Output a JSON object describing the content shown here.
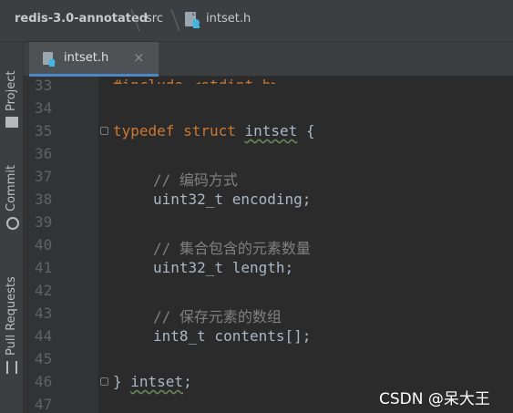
{
  "breadcrumb": {
    "project": "redis-3.0-annotated",
    "folder": "src",
    "file": "intset.h"
  },
  "side_tabs": {
    "project": "Project",
    "commit": "Commit",
    "pull_requests": "Pull Requests"
  },
  "editor_tab": {
    "label": "intset.h",
    "close": "×"
  },
  "lines": [
    {
      "num": "33",
      "code": "#include <stdint.h>"
    },
    {
      "num": "34",
      "code": ""
    },
    {
      "num": "35",
      "kw1": "typedef",
      "kw2": "struct",
      "name": "intset",
      "tail": " {"
    },
    {
      "num": "36",
      "code": ""
    },
    {
      "num": "37",
      "comment": "// 编码方式"
    },
    {
      "num": "38",
      "code": "uint32_t encoding;"
    },
    {
      "num": "39",
      "code": ""
    },
    {
      "num": "40",
      "comment": "// 集合包含的元素数量"
    },
    {
      "num": "41",
      "code": "uint32_t length;"
    },
    {
      "num": "42",
      "code": ""
    },
    {
      "num": "43",
      "comment": "// 保存元素的数组"
    },
    {
      "num": "44",
      "code": "int8_t contents[];"
    },
    {
      "num": "45",
      "code": ""
    },
    {
      "num": "46",
      "head": "} ",
      "name": "intset",
      "tail": ";"
    },
    {
      "num": "47",
      "code": ""
    }
  ],
  "watermark": "CSDN @呆大王",
  "colors": {
    "background": "#2b2b2b",
    "keyword": "#cc7832",
    "comment": "#808080",
    "text": "#a9b7c6",
    "line_number": "#606366"
  }
}
